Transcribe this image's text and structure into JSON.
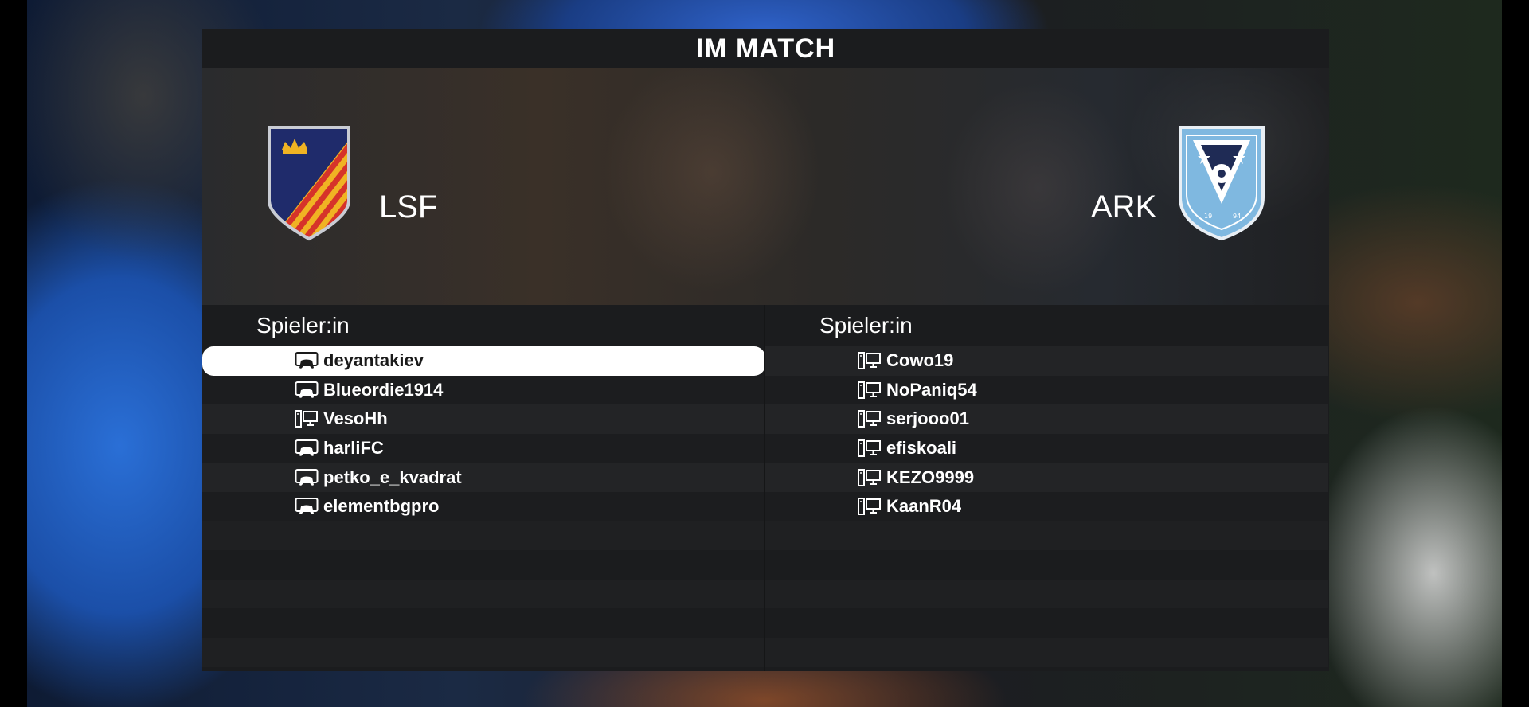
{
  "screen": {
    "title": "IM MATCH"
  },
  "home": {
    "team_name": "LSF",
    "crest_icon": "lsf-crest-icon",
    "column_header": "Spieler:in",
    "players": [
      {
        "name": "deyantakiev",
        "platform_icon": "console-icon",
        "selected": true
      },
      {
        "name": "Blueordie1914",
        "platform_icon": "console-icon",
        "selected": false
      },
      {
        "name": "VesoHh",
        "platform_icon": "pc-icon",
        "selected": false
      },
      {
        "name": "harliFC",
        "platform_icon": "console-icon",
        "selected": false
      },
      {
        "name": "petko_e_kvadrat",
        "platform_icon": "console-icon",
        "selected": false
      },
      {
        "name": "elementbgpro",
        "platform_icon": "console-icon",
        "selected": false
      }
    ]
  },
  "away": {
    "team_name": "ARK",
    "crest_icon": "ark-crest-icon",
    "crest_text": "19 94",
    "column_header": "Spieler:in",
    "players": [
      {
        "name": "Cowo19",
        "platform_icon": "pc-icon"
      },
      {
        "name": "NoPaniq54",
        "platform_icon": "pc-icon"
      },
      {
        "name": "serjooo01",
        "platform_icon": "pc-icon"
      },
      {
        "name": "efiskoali",
        "platform_icon": "pc-icon"
      },
      {
        "name": "KEZO9999",
        "platform_icon": "pc-icon"
      },
      {
        "name": "KaanR04",
        "platform_icon": "pc-icon"
      }
    ]
  },
  "colors": {
    "panel_bg": "#1b1c1e",
    "selected_row_bg": "#ffffff",
    "lsf_navy": "#1f2b6b",
    "lsf_gold": "#f0b323",
    "lsf_red": "#d6332a",
    "ark_blue": "#7fb8e0"
  }
}
